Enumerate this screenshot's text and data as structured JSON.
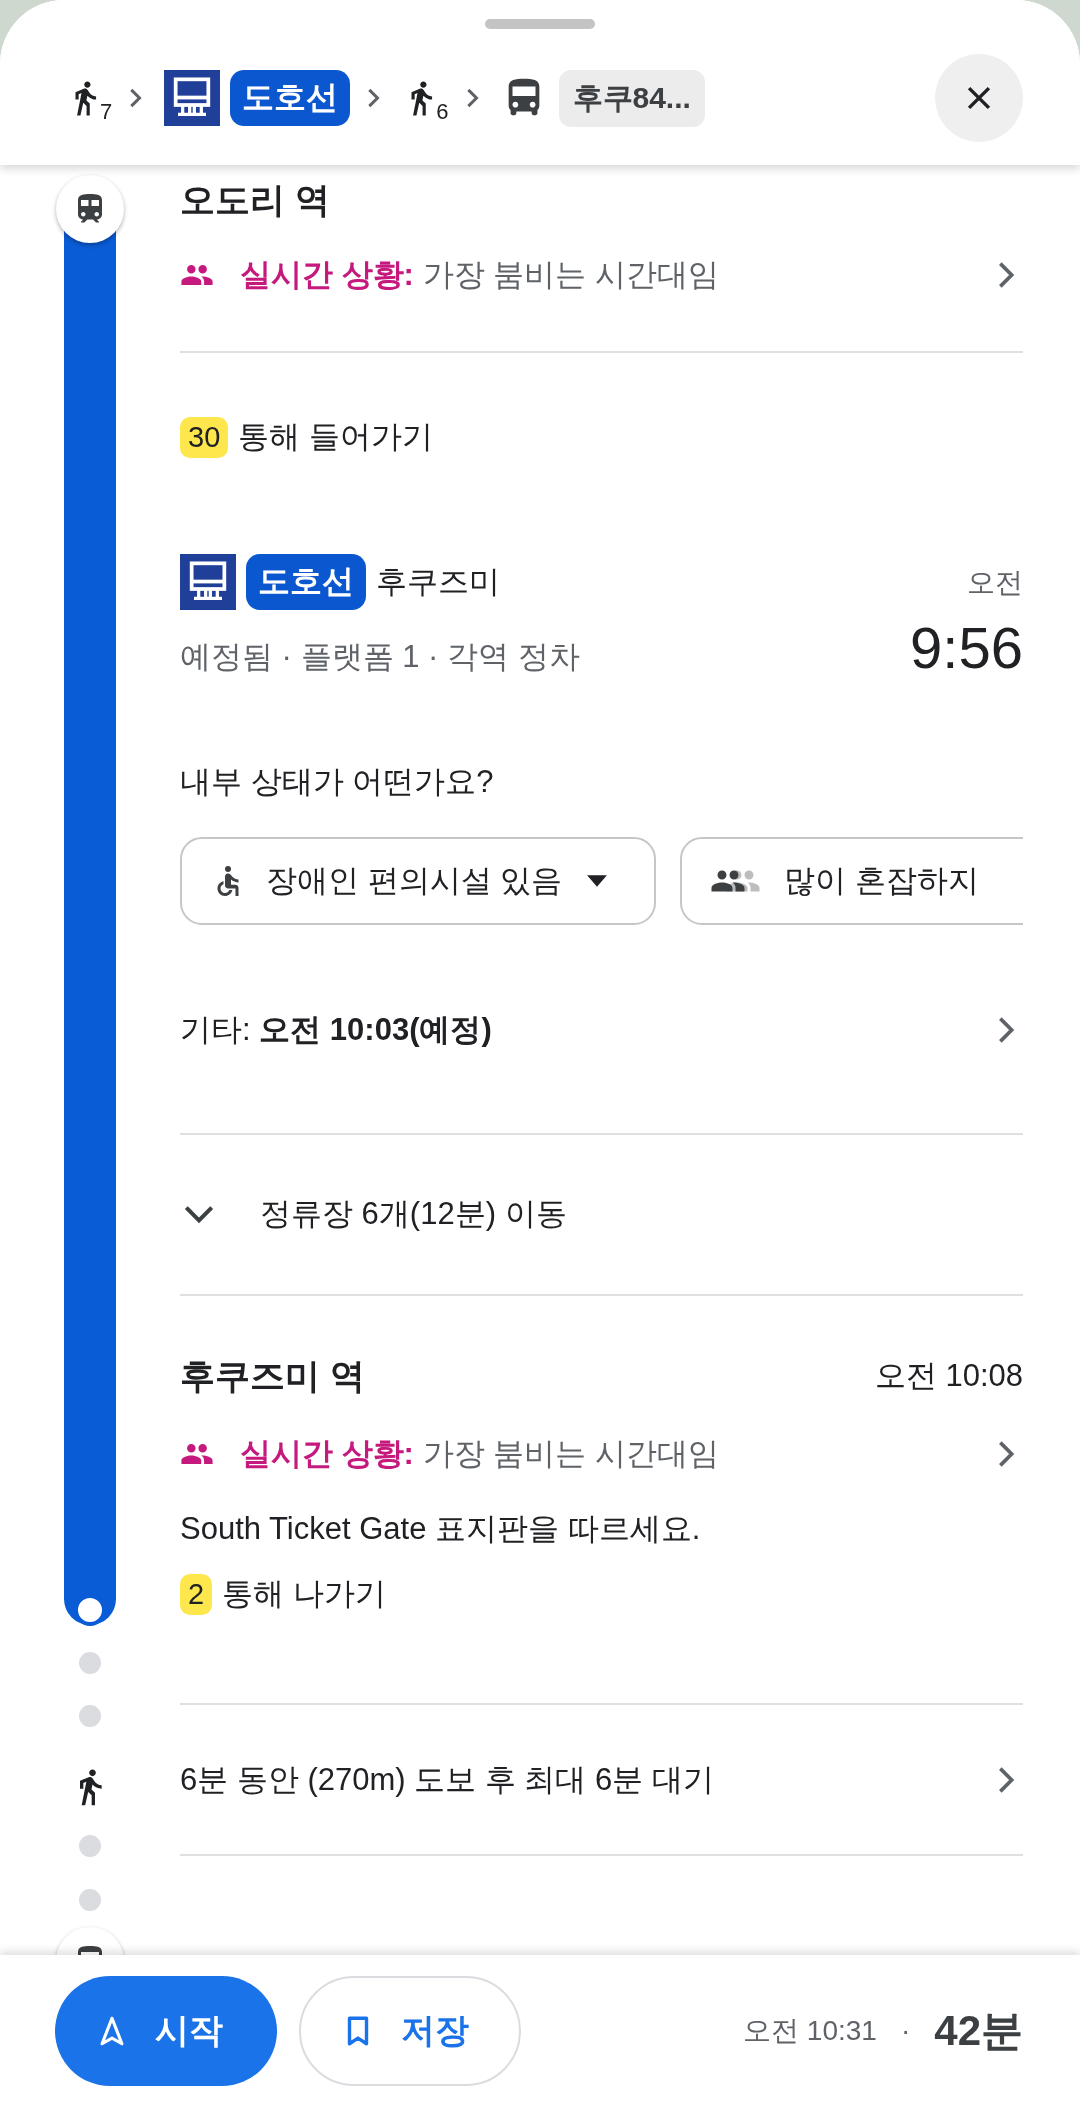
{
  "header": {
    "steps": [
      {
        "kind": "walk",
        "minutes": "7"
      },
      {
        "kind": "rail",
        "line": "도호선"
      },
      {
        "kind": "walk",
        "minutes": "6"
      },
      {
        "kind": "bus",
        "line": "후쿠84..."
      }
    ]
  },
  "itinerary": {
    "origin": {
      "name": "오도리 역",
      "live_label": "실시간 상황:",
      "live_text": "가장 붐비는 시간대임"
    },
    "entrance": {
      "exit_number": "30",
      "text": "통해 들어가기"
    },
    "ride": {
      "line": "도호선",
      "destination": "후쿠즈미",
      "details": "예정됨 · 플랫폼 1 · 각역 정차",
      "period": "오전",
      "time": "9:56"
    },
    "question": "내부 상태가 어떤가요?",
    "chips": [
      {
        "kind": "accessibility",
        "label": "장애인 편의시설 있음",
        "dropdown": true
      },
      {
        "kind": "crowd",
        "label": "많이 혼잡하지",
        "dropdown": false
      }
    ],
    "other_departures": "기타: **오전 10:03(예정)**",
    "stops": {
      "text": "정류장 6개(12분) 이동",
      "expanded": false
    },
    "arrival": {
      "name": "후쿠즈미 역",
      "time": "오전 10:08",
      "live_label": "실시간 상황:",
      "live_text": "가장 붐비는 시간대임",
      "instruction": "South Ticket Gate 표지판을 따르세요.",
      "exit_number": "2",
      "exit_text": "통해 나가기"
    },
    "walk": {
      "text": "6분 동안 (270m) 도보 후 최대 6분 대기"
    }
  },
  "footer": {
    "start": "시작",
    "save": "저장",
    "arrival": "오전 10:31",
    "separator": "·",
    "duration": "42분"
  }
}
